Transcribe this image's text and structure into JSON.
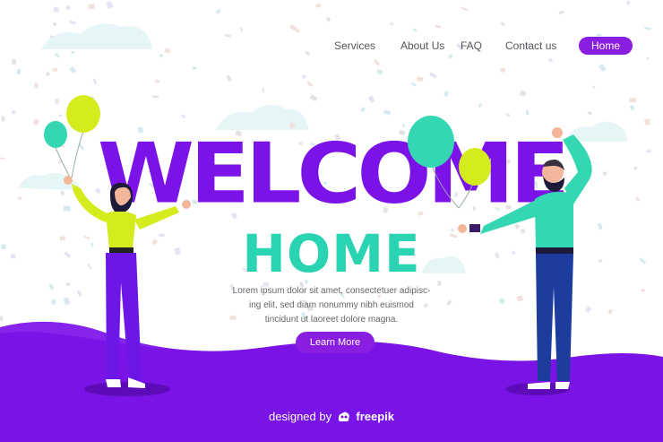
{
  "nav": {
    "items": [
      {
        "label": "Services"
      },
      {
        "label": "About Us"
      },
      {
        "label": "FAQ"
      },
      {
        "label": "Contact us"
      },
      {
        "label": "Home",
        "active": true
      }
    ]
  },
  "hero": {
    "headline": "WELCOME",
    "subheadline": "HOME",
    "body_lines": [
      "Lorem ipsum dolor sit amet, consectetuer adipisc-",
      "ing elit, sed diam nonummy nibh euismod",
      "tincidunt ut laoreet dolore magna."
    ],
    "cta_label": "Learn More"
  },
  "footer": {
    "credit_prefix": "designed by",
    "credit_brand": "freepik"
  },
  "colors": {
    "accent": "#8a1ee0",
    "headline": "#7b12e8",
    "teal": "#2ad3b1",
    "wave": "#7a14e6"
  },
  "icons": [
    "freepik-logo-icon",
    "balloon-icon",
    "confetti"
  ]
}
